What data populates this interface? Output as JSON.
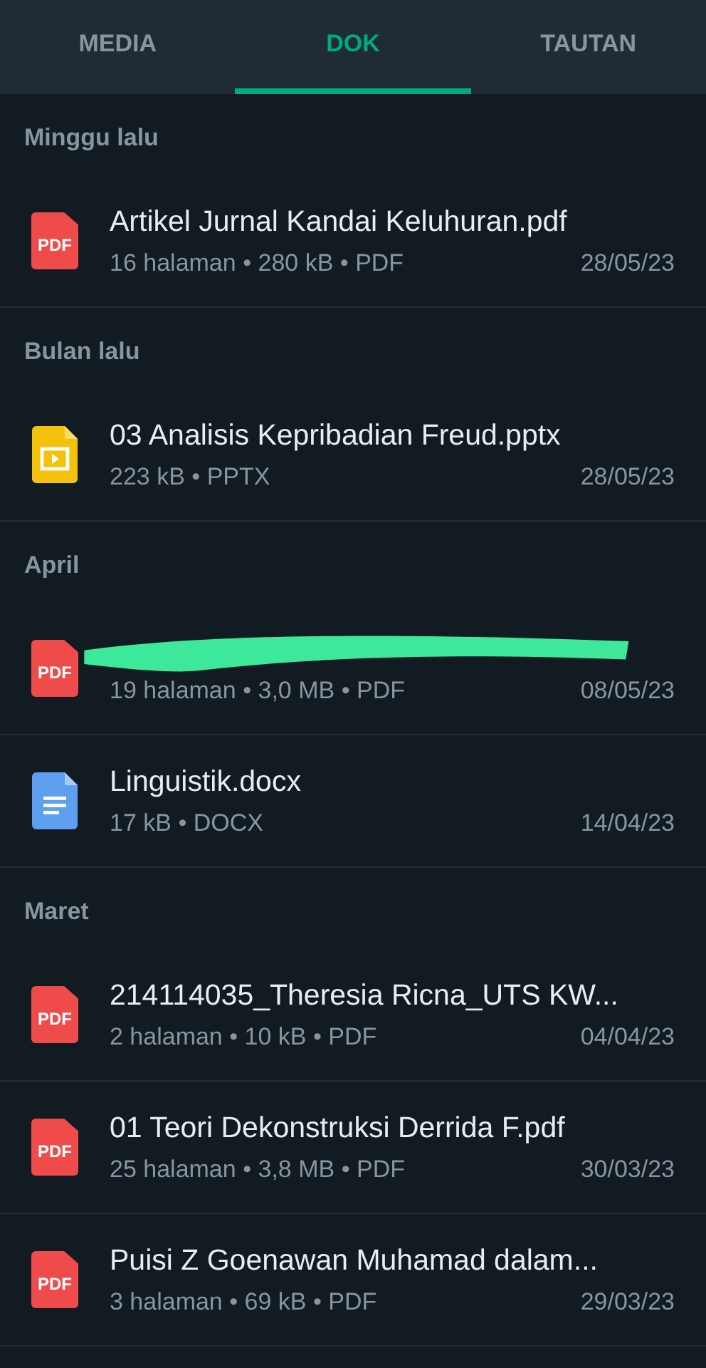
{
  "tabs": [
    {
      "label": "MEDIA",
      "selected": false
    },
    {
      "label": "DOK",
      "selected": true
    },
    {
      "label": "TAUTAN",
      "selected": false
    }
  ],
  "sections": [
    {
      "title": "Minggu lalu",
      "docs": [
        {
          "kind": "pdf",
          "badge": "PDF",
          "title": "Artikel Jurnal Kandai Keluhuran.pdf",
          "meta": "16 halaman • 280 kB • PDF",
          "date": "28/05/23"
        }
      ]
    },
    {
      "title": "Bulan lalu",
      "docs": [
        {
          "kind": "slides",
          "title": "03 Analisis Kepribadian Freud.pptx",
          "meta": "223 kB • PPTX",
          "date": "28/05/23"
        }
      ]
    },
    {
      "title": "April",
      "docs": [
        {
          "kind": "pdf",
          "badge": "PDF",
          "redacted": true,
          "meta": "19 halaman • 3,0 MB • PDF",
          "date": "08/05/23"
        },
        {
          "kind": "doc",
          "title": "Linguistik.docx",
          "meta": "17 kB • DOCX",
          "date": "14/04/23"
        }
      ]
    },
    {
      "title": "Maret",
      "docs": [
        {
          "kind": "pdf",
          "badge": "PDF",
          "title": "214114035_Theresia Ricna_UTS KW...",
          "meta": "2 halaman • 10 kB • PDF",
          "date": "04/04/23"
        },
        {
          "kind": "pdf",
          "badge": "PDF",
          "title": "01 Teori Dekonstruksi Derrida F.pdf",
          "meta": "25 halaman • 3,8 MB • PDF",
          "date": "30/03/23"
        },
        {
          "kind": "pdf",
          "badge": "PDF",
          "title": "Puisi Z Goenawan Muhamad dalam...",
          "meta": "3 halaman • 69 kB • PDF",
          "date": "29/03/23"
        }
      ]
    }
  ]
}
